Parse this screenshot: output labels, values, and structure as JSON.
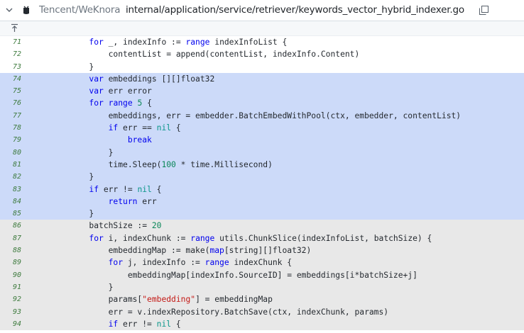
{
  "header": {
    "repo": "Tencent/WeKnora",
    "file_path": "internal/application/service/retriever/keywords_vector_hybrid_indexer.go",
    "icons": [
      "chevron-down-icon",
      "github-icon",
      "copy-icon",
      "expand-up-icon"
    ]
  },
  "colors": {
    "highlight_bg": "#ccdaf9",
    "context_bg": "#e8e8e8",
    "keyword": "#0000ee",
    "number": "#098658",
    "string": "#c41a16",
    "line_number": "#3d7a3d"
  },
  "code": {
    "lines": [
      {
        "n": "71",
        "state": "ctx",
        "tokens": [
          [
            "        ",
            ""
          ],
          [
            "for",
            "kw"
          ],
          [
            " _, indexInfo := ",
            ""
          ],
          [
            "range",
            "kw"
          ],
          [
            " indexInfoList {",
            ""
          ]
        ]
      },
      {
        "n": "72",
        "state": "ctx",
        "tokens": [
          [
            "            contentList = append(contentList, indexInfo.Content)",
            ""
          ]
        ]
      },
      {
        "n": "73",
        "state": "ctx",
        "tokens": [
          [
            "        }",
            ""
          ]
        ]
      },
      {
        "n": "74",
        "state": "hl",
        "tokens": [
          [
            "        ",
            ""
          ],
          [
            "var",
            "kw"
          ],
          [
            " embeddings [][]float32",
            ""
          ]
        ]
      },
      {
        "n": "75",
        "state": "hl",
        "tokens": [
          [
            "        ",
            ""
          ],
          [
            "var",
            "kw"
          ],
          [
            " err error",
            ""
          ]
        ]
      },
      {
        "n": "76",
        "state": "hl",
        "tokens": [
          [
            "        ",
            ""
          ],
          [
            "for",
            "kw"
          ],
          [
            " ",
            ""
          ],
          [
            "range",
            "kw"
          ],
          [
            " ",
            ""
          ],
          [
            "5",
            "num"
          ],
          [
            " {",
            ""
          ]
        ]
      },
      {
        "n": "77",
        "state": "hl",
        "tokens": [
          [
            "            embeddings, err = embedder.BatchEmbedWithPool(ctx, embedder, contentList)",
            ""
          ]
        ]
      },
      {
        "n": "78",
        "state": "hl",
        "tokens": [
          [
            "            ",
            ""
          ],
          [
            "if",
            "kw"
          ],
          [
            " err == ",
            ""
          ],
          [
            "nil",
            "lit"
          ],
          [
            " {",
            ""
          ]
        ]
      },
      {
        "n": "79",
        "state": "hl",
        "tokens": [
          [
            "                ",
            ""
          ],
          [
            "break",
            "kw"
          ]
        ]
      },
      {
        "n": "80",
        "state": "hl",
        "tokens": [
          [
            "            }",
            ""
          ]
        ]
      },
      {
        "n": "81",
        "state": "hl",
        "tokens": [
          [
            "            time.Sleep(",
            ""
          ],
          [
            "100",
            "num"
          ],
          [
            " * time.Millisecond)",
            ""
          ]
        ]
      },
      {
        "n": "82",
        "state": "hl",
        "tokens": [
          [
            "        }",
            ""
          ]
        ]
      },
      {
        "n": "83",
        "state": "hl",
        "tokens": [
          [
            "        ",
            ""
          ],
          [
            "if",
            "kw"
          ],
          [
            " err != ",
            ""
          ],
          [
            "nil",
            "lit"
          ],
          [
            " {",
            ""
          ]
        ]
      },
      {
        "n": "84",
        "state": "hl",
        "tokens": [
          [
            "            ",
            ""
          ],
          [
            "return",
            "kw"
          ],
          [
            " err",
            ""
          ]
        ]
      },
      {
        "n": "85",
        "state": "hl",
        "tokens": [
          [
            "        }",
            ""
          ]
        ]
      },
      {
        "n": "86",
        "state": "ctx2",
        "tokens": [
          [
            "        batchSize := ",
            ""
          ],
          [
            "20",
            "num"
          ]
        ]
      },
      {
        "n": "87",
        "state": "ctx2",
        "tokens": [
          [
            "        ",
            ""
          ],
          [
            "for",
            "kw"
          ],
          [
            " i, indexChunk := ",
            ""
          ],
          [
            "range",
            "kw"
          ],
          [
            " utils.ChunkSlice(indexInfoList, batchSize) {",
            ""
          ]
        ]
      },
      {
        "n": "88",
        "state": "ctx2",
        "tokens": [
          [
            "            embeddingMap := make(",
            ""
          ],
          [
            "map",
            "kw"
          ],
          [
            "[string][]float32)",
            ""
          ]
        ]
      },
      {
        "n": "89",
        "state": "ctx2",
        "tokens": [
          [
            "            ",
            ""
          ],
          [
            "for",
            "kw"
          ],
          [
            " j, indexInfo := ",
            ""
          ],
          [
            "range",
            "kw"
          ],
          [
            " indexChunk {",
            ""
          ]
        ]
      },
      {
        "n": "90",
        "state": "ctx2",
        "tokens": [
          [
            "                embeddingMap[indexInfo.SourceID] = embeddings[i*batchSize+j]",
            ""
          ]
        ]
      },
      {
        "n": "91",
        "state": "ctx2",
        "tokens": [
          [
            "            }",
            ""
          ]
        ]
      },
      {
        "n": "92",
        "state": "ctx2",
        "tokens": [
          [
            "            params[",
            ""
          ],
          [
            "\"embedding\"",
            "str"
          ],
          [
            "] = embeddingMap",
            ""
          ]
        ]
      },
      {
        "n": "93",
        "state": "ctx2",
        "tokens": [
          [
            "            err = v.indexRepository.BatchSave(ctx, indexChunk, params)",
            ""
          ]
        ]
      },
      {
        "n": "94",
        "state": "ctx2",
        "tokens": [
          [
            "            ",
            ""
          ],
          [
            "if",
            "kw"
          ],
          [
            " err != ",
            ""
          ],
          [
            "nil",
            "lit"
          ],
          [
            " {",
            ""
          ]
        ]
      }
    ]
  }
}
